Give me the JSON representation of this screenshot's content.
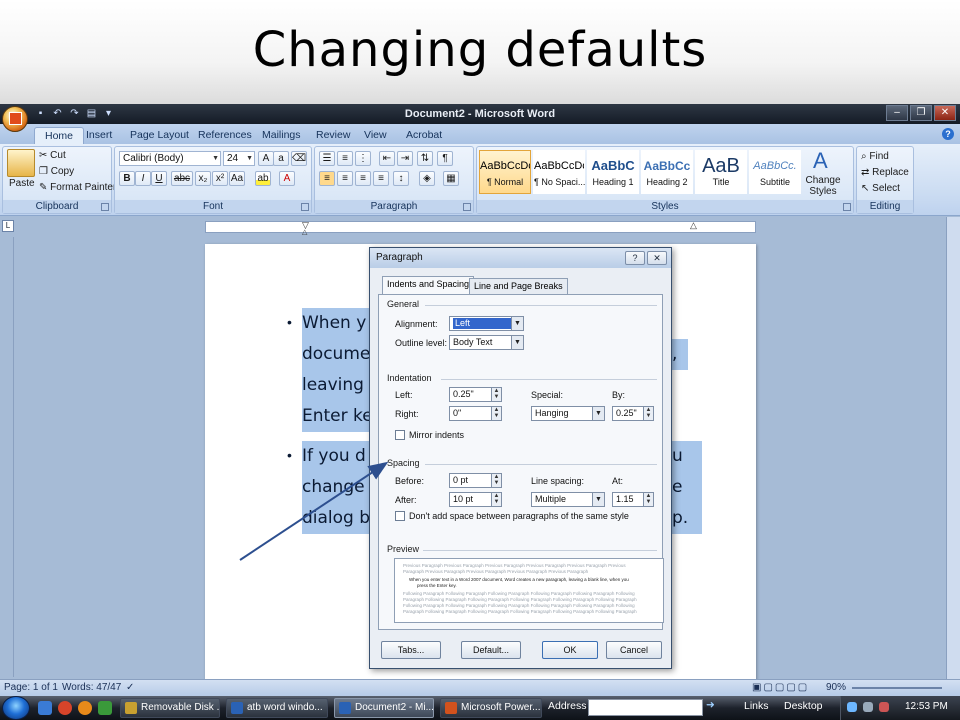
{
  "slide": {
    "title": "Changing defaults"
  },
  "window": {
    "title": "Document2 - Microsoft Word",
    "tabs": [
      "Home",
      "Insert",
      "Page Layout",
      "References",
      "Mailings",
      "Review",
      "View",
      "Acrobat"
    ],
    "active_tab": "Home"
  },
  "ribbon": {
    "clipboard": {
      "paste": "Paste",
      "cut": "Cut",
      "copy": "Copy",
      "format_painter": "Format Painter",
      "label": "Clipboard"
    },
    "font": {
      "name": "Calibri (Body)",
      "size": "24",
      "label": "Font"
    },
    "paragraph": {
      "label": "Paragraph"
    },
    "styles": {
      "items": [
        {
          "preview": "AaBbCcDc",
          "name": "¶ Normal"
        },
        {
          "preview": "AaBbCcDc",
          "name": "¶ No Spaci..."
        },
        {
          "preview": "AaBbC",
          "name": "Heading 1"
        },
        {
          "preview": "AaBbCc",
          "name": "Heading 2"
        },
        {
          "preview": "AaB",
          "name": "Title"
        },
        {
          "preview": "AaBbCc.",
          "name": "Subtitle"
        }
      ],
      "change_styles": "Change Styles",
      "label": "Styles"
    },
    "editing": {
      "find": "Find",
      "replace": "Replace",
      "select": "Select",
      "label": "Editing"
    }
  },
  "document": {
    "bullet1": [
      "When y",
      "docume",
      "leaving",
      "Enter ke"
    ],
    "bullet1_tail": [
      "",
      "",
      "",
      ""
    ],
    "bullet1_right": [
      "",
      ",",
      "",
      ""
    ],
    "bullet2": [
      "If you d",
      "change",
      "dialog b"
    ],
    "bullet2_right": [
      "u",
      "e",
      "p."
    ]
  },
  "dialog": {
    "title": "Paragraph",
    "tabs": [
      "Indents and Spacing",
      "Line and Page Breaks"
    ],
    "general": {
      "heading": "General",
      "alignment_label": "Alignment:",
      "alignment_value": "Left",
      "outline_label": "Outline level:",
      "outline_value": "Body Text"
    },
    "indentation": {
      "heading": "Indentation",
      "left_label": "Left:",
      "left_value": "0.25\"",
      "right_label": "Right:",
      "right_value": "0\"",
      "special_label": "Special:",
      "special_value": "Hanging",
      "by_label": "By:",
      "by_value": "0.25\"",
      "mirror_label": "Mirror indents"
    },
    "spacing": {
      "heading": "Spacing",
      "before_label": "Before:",
      "before_value": "0 pt",
      "after_label": "After:",
      "after_value": "10 pt",
      "line_label": "Line spacing:",
      "line_value": "Multiple",
      "at_label": "At:",
      "at_value": "1.15",
      "dont_add_label": "Don't add space between paragraphs of the same style"
    },
    "preview": {
      "heading": "Preview",
      "prev_lines": [
        "Previous Paragraph Previous Paragraph Previous Paragraph Previous Paragraph Previous Paragraph Previous",
        "Paragraph Previous Paragraph Previous Paragraph Previous Paragraph Previous Paragraph"
      ],
      "sample_lines": [
        "When you enter text in a Word 2007 document, Word creates a new paragraph, leaving a blank line, when you",
        "press the Enter key."
      ],
      "next_lines": [
        "Following Paragraph Following Paragraph Following Paragraph Following Paragraph Following Paragraph Following",
        "Paragraph Following Paragraph Following Paragraph Following Paragraph Following Paragraph Following Paragraph",
        "Following Paragraph Following Paragraph Following Paragraph Following Paragraph Following Paragraph Following",
        "Paragraph Following Paragraph Following Paragraph Following Paragraph Following Paragraph Following Paragraph"
      ]
    },
    "buttons": {
      "tabs": "Tabs...",
      "default": "Default...",
      "ok": "OK",
      "cancel": "Cancel"
    }
  },
  "status": {
    "page": "Page: 1 of 1",
    "words": "Words: 47/47",
    "zoom": "90%"
  },
  "taskbar": {
    "tasks": [
      "Removable Disk ...",
      "atb word windo...",
      "Document2 - Mi...",
      "Microsoft Power..."
    ],
    "address_label": "Address",
    "links": "Links",
    "desktop": "Desktop",
    "time": "12:53 PM"
  }
}
